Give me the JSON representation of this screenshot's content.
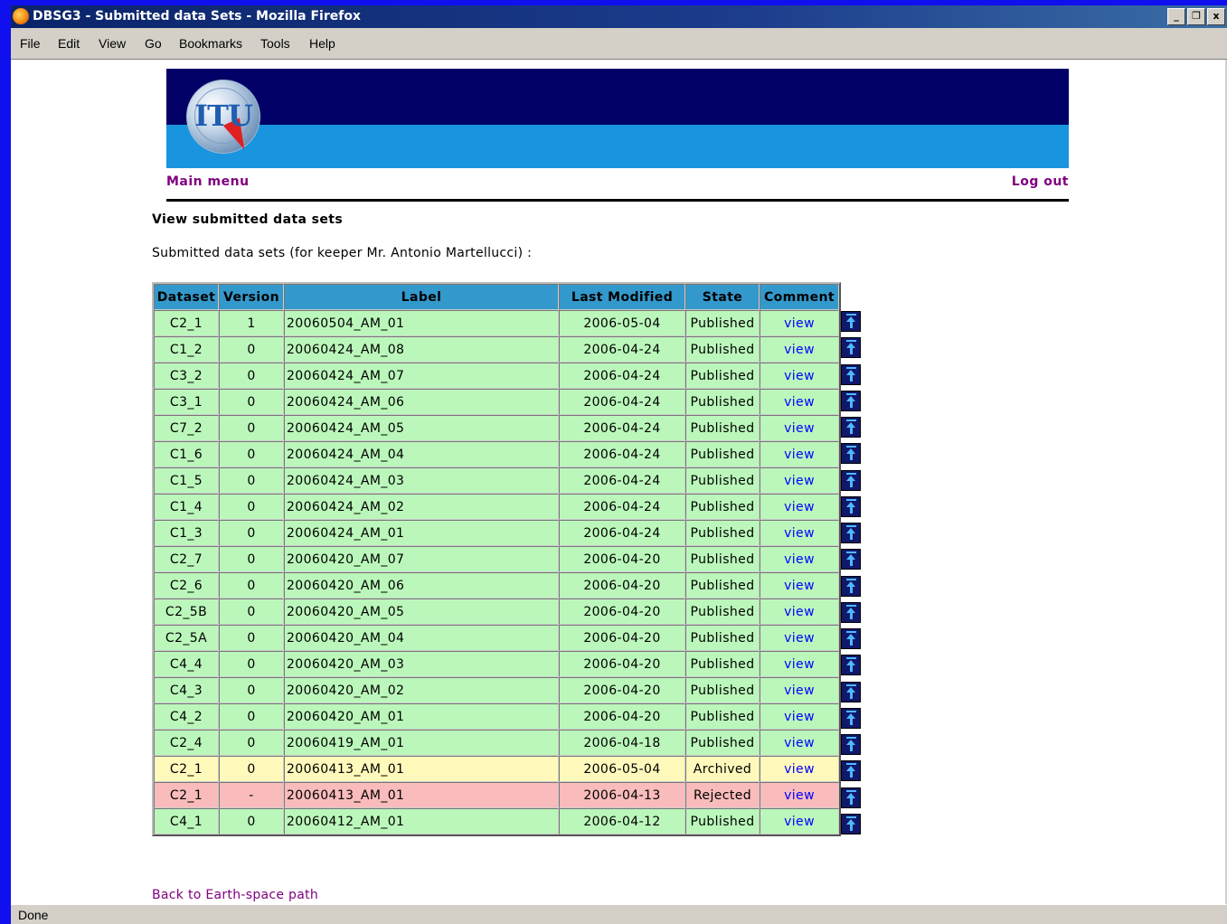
{
  "window": {
    "title": "DBSG3 - Submitted data Sets - Mozilla Firefox",
    "controls": [
      "_",
      "❐",
      "x"
    ]
  },
  "menubar": [
    "File",
    "Edit",
    "View",
    "Go",
    "Bookmarks",
    "Tools",
    "Help"
  ],
  "banner": {
    "logo_text": "ITU"
  },
  "nav": {
    "main_menu": "Main menu",
    "log_out": "Log out"
  },
  "page": {
    "heading": "View submitted data sets",
    "subheading": "Submitted data sets (for keeper Mr. Antonio Martellucci) :"
  },
  "table": {
    "columns": [
      "Dataset",
      "Version",
      "Label",
      "Last Modified",
      "State",
      "Comment"
    ],
    "state_colors": {
      "Published": "#bbf7bb",
      "Archived": "#fff9bb",
      "Rejected": "#f9bbbb"
    },
    "rows": [
      {
        "dataset": "C2_1",
        "version": "1",
        "label": "20060504_AM_01",
        "modified": "2006-05-04",
        "state": "Published",
        "comment": "view"
      },
      {
        "dataset": "C1_2",
        "version": "0",
        "label": "20060424_AM_08",
        "modified": "2006-04-24",
        "state": "Published",
        "comment": "view"
      },
      {
        "dataset": "C3_2",
        "version": "0",
        "label": "20060424_AM_07",
        "modified": "2006-04-24",
        "state": "Published",
        "comment": "view"
      },
      {
        "dataset": "C3_1",
        "version": "0",
        "label": "20060424_AM_06",
        "modified": "2006-04-24",
        "state": "Published",
        "comment": "view"
      },
      {
        "dataset": "C7_2",
        "version": "0",
        "label": "20060424_AM_05",
        "modified": "2006-04-24",
        "state": "Published",
        "comment": "view"
      },
      {
        "dataset": "C1_6",
        "version": "0",
        "label": "20060424_AM_04",
        "modified": "2006-04-24",
        "state": "Published",
        "comment": "view"
      },
      {
        "dataset": "C1_5",
        "version": "0",
        "label": "20060424_AM_03",
        "modified": "2006-04-24",
        "state": "Published",
        "comment": "view"
      },
      {
        "dataset": "C1_4",
        "version": "0",
        "label": "20060424_AM_02",
        "modified": "2006-04-24",
        "state": "Published",
        "comment": "view"
      },
      {
        "dataset": "C1_3",
        "version": "0",
        "label": "20060424_AM_01",
        "modified": "2006-04-24",
        "state": "Published",
        "comment": "view"
      },
      {
        "dataset": "C2_7",
        "version": "0",
        "label": "20060420_AM_07",
        "modified": "2006-04-20",
        "state": "Published",
        "comment": "view"
      },
      {
        "dataset": "C2_6",
        "version": "0",
        "label": "20060420_AM_06",
        "modified": "2006-04-20",
        "state": "Published",
        "comment": "view"
      },
      {
        "dataset": "C2_5B",
        "version": "0",
        "label": "20060420_AM_05",
        "modified": "2006-04-20",
        "state": "Published",
        "comment": "view"
      },
      {
        "dataset": "C2_5A",
        "version": "0",
        "label": "20060420_AM_04",
        "modified": "2006-04-20",
        "state": "Published",
        "comment": "view"
      },
      {
        "dataset": "C4_4",
        "version": "0",
        "label": "20060420_AM_03",
        "modified": "2006-04-20",
        "state": "Published",
        "comment": "view"
      },
      {
        "dataset": "C4_3",
        "version": "0",
        "label": "20060420_AM_02",
        "modified": "2006-04-20",
        "state": "Published",
        "comment": "view"
      },
      {
        "dataset": "C4_2",
        "version": "0",
        "label": "20060420_AM_01",
        "modified": "2006-04-20",
        "state": "Published",
        "comment": "view"
      },
      {
        "dataset": "C2_4",
        "version": "0",
        "label": "20060419_AM_01",
        "modified": "2006-04-18",
        "state": "Published",
        "comment": "view"
      },
      {
        "dataset": "C2_1",
        "version": "0",
        "label": "20060413_AM_01",
        "modified": "2006-05-04",
        "state": "Archived",
        "comment": "view"
      },
      {
        "dataset": "C2_1",
        "version": "-",
        "label": "20060413_AM_01",
        "modified": "2006-04-13",
        "state": "Rejected",
        "comment": "view"
      },
      {
        "dataset": "C4_1",
        "version": "0",
        "label": "20060412_AM_01",
        "modified": "2006-04-12",
        "state": "Published",
        "comment": "view"
      }
    ]
  },
  "back_link": "Back to Earth-space path",
  "statusbar": {
    "text": "Done"
  }
}
